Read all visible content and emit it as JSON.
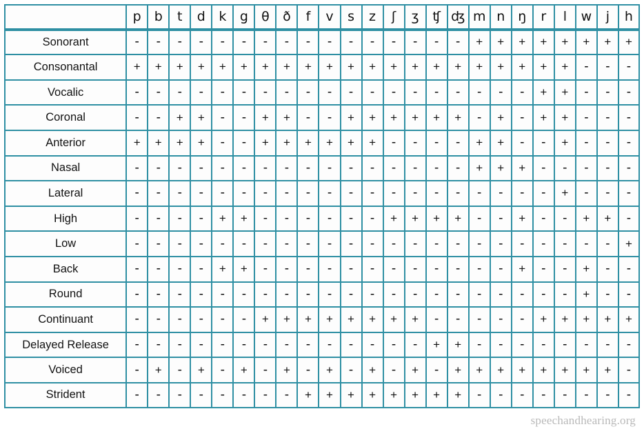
{
  "table": {
    "corner_label": "",
    "symbols": [
      "p",
      "b",
      "t",
      "d",
      "k",
      "g",
      "θ",
      "ð",
      "f",
      "v",
      "s",
      "z",
      "ʃ",
      "ʒ",
      "ʧ",
      "ʤ",
      "m",
      "n",
      "ŋ",
      "r",
      "l",
      "w",
      "j",
      "h"
    ],
    "plus": "+",
    "minus": "-",
    "rows": [
      {
        "label": "Sonorant",
        "values": [
          "-",
          "-",
          "-",
          "-",
          "-",
          "-",
          "-",
          "-",
          "-",
          "-",
          "-",
          "-",
          "-",
          "-",
          "-",
          "-",
          "+",
          "+",
          "+",
          "+",
          "+",
          "+",
          "+",
          "+"
        ]
      },
      {
        "label": "Consonantal",
        "values": [
          "+",
          "+",
          "+",
          "+",
          "+",
          "+",
          "+",
          "+",
          "+",
          "+",
          "+",
          "+",
          "+",
          "+",
          "+",
          "+",
          "+",
          "+",
          "+",
          "+",
          "+",
          "-",
          "-",
          "-"
        ]
      },
      {
        "label": "Vocalic",
        "values": [
          "-",
          "-",
          "-",
          "-",
          "-",
          "-",
          "-",
          "-",
          "-",
          "-",
          "-",
          "-",
          "-",
          "-",
          "-",
          "-",
          "-",
          "-",
          "-",
          "+",
          "+",
          "-",
          "-",
          "-"
        ]
      },
      {
        "label": "Coronal",
        "values": [
          "-",
          "-",
          "+",
          "+",
          "-",
          "-",
          "+",
          "+",
          "-",
          "-",
          "+",
          "+",
          "+",
          "+",
          "+",
          "+",
          "-",
          "+",
          "-",
          "+",
          "+",
          "-",
          "-",
          "-"
        ]
      },
      {
        "label": "Anterior",
        "values": [
          "+",
          "+",
          "+",
          "+",
          "-",
          "-",
          "+",
          "+",
          "+",
          "+",
          "+",
          "+",
          "-",
          "-",
          "-",
          "-",
          "+",
          "+",
          "-",
          "-",
          "+",
          "-",
          "-",
          "-"
        ]
      },
      {
        "label": "Nasal",
        "values": [
          "-",
          "-",
          "-",
          "-",
          "-",
          "-",
          "-",
          "-",
          "-",
          "-",
          "-",
          "-",
          "-",
          "-",
          "-",
          "-",
          "+",
          "+",
          "+",
          "-",
          "-",
          "-",
          "-",
          "-"
        ]
      },
      {
        "label": "Lateral",
        "values": [
          "-",
          "-",
          "-",
          "-",
          "-",
          "-",
          "-",
          "-",
          "-",
          "-",
          "-",
          "-",
          "-",
          "-",
          "-",
          "-",
          "-",
          "-",
          "-",
          "-",
          "+",
          "-",
          "-",
          "-"
        ]
      },
      {
        "label": "High",
        "values": [
          "-",
          "-",
          "-",
          "-",
          "+",
          "+",
          "-",
          "-",
          "-",
          "-",
          "-",
          "-",
          "+",
          "+",
          "+",
          "+",
          "-",
          "-",
          "+",
          "-",
          "-",
          "+",
          "+",
          "-"
        ]
      },
      {
        "label": "Low",
        "values": [
          "-",
          "-",
          "-",
          "-",
          "-",
          "-",
          "-",
          "-",
          "-",
          "-",
          "-",
          "-",
          "-",
          "-",
          "-",
          "-",
          "-",
          "-",
          "-",
          "-",
          "-",
          "-",
          "-",
          "+"
        ]
      },
      {
        "label": "Back",
        "values": [
          "-",
          "-",
          "-",
          "-",
          "+",
          "+",
          "-",
          "-",
          "-",
          "-",
          "-",
          "-",
          "-",
          "-",
          "-",
          "-",
          "-",
          "-",
          "+",
          "-",
          "-",
          "+",
          "-",
          "-"
        ]
      },
      {
        "label": "Round",
        "values": [
          "-",
          "-",
          "-",
          "-",
          "-",
          "-",
          "-",
          "-",
          "-",
          "-",
          "-",
          "-",
          "-",
          "-",
          "-",
          "-",
          "-",
          "-",
          "-",
          "-",
          "-",
          "+",
          "-",
          "-"
        ]
      },
      {
        "label": "Continuant",
        "values": [
          "-",
          "-",
          "-",
          "-",
          "-",
          "-",
          "+",
          "+",
          "+",
          "+",
          "+",
          "+",
          "+",
          "+",
          "-",
          "-",
          "-",
          "-",
          "-",
          "+",
          "+",
          "+",
          "+",
          "+"
        ]
      },
      {
        "label": "Delayed Release",
        "values": [
          "-",
          "-",
          "-",
          "-",
          "-",
          "-",
          "-",
          "-",
          "-",
          "-",
          "-",
          "-",
          "-",
          "-",
          "+",
          "+",
          "-",
          "-",
          "-",
          "-",
          "-",
          "-",
          "-",
          "-"
        ]
      },
      {
        "label": "Voiced",
        "values": [
          "-",
          "+",
          "-",
          "+",
          "-",
          "+",
          "-",
          "+",
          "-",
          "+",
          "-",
          "+",
          "-",
          "+",
          "-",
          "+",
          "+",
          "+",
          "+",
          "+",
          "+",
          "+",
          "+",
          "-"
        ]
      },
      {
        "label": "Strident",
        "values": [
          "-",
          "-",
          "-",
          "-",
          "-",
          "-",
          "-",
          "-",
          "+",
          "+",
          "+",
          "+",
          "+",
          "+",
          "+",
          "+",
          "-",
          "-",
          "-",
          "-",
          "-",
          "-",
          "-",
          "-"
        ]
      }
    ]
  },
  "footer": {
    "watermark": "speechandhearing.org"
  },
  "colors": {
    "border": "#2e8fa3",
    "text": "#111111",
    "watermark": "#b9b9b9",
    "background": "#ffffff"
  }
}
